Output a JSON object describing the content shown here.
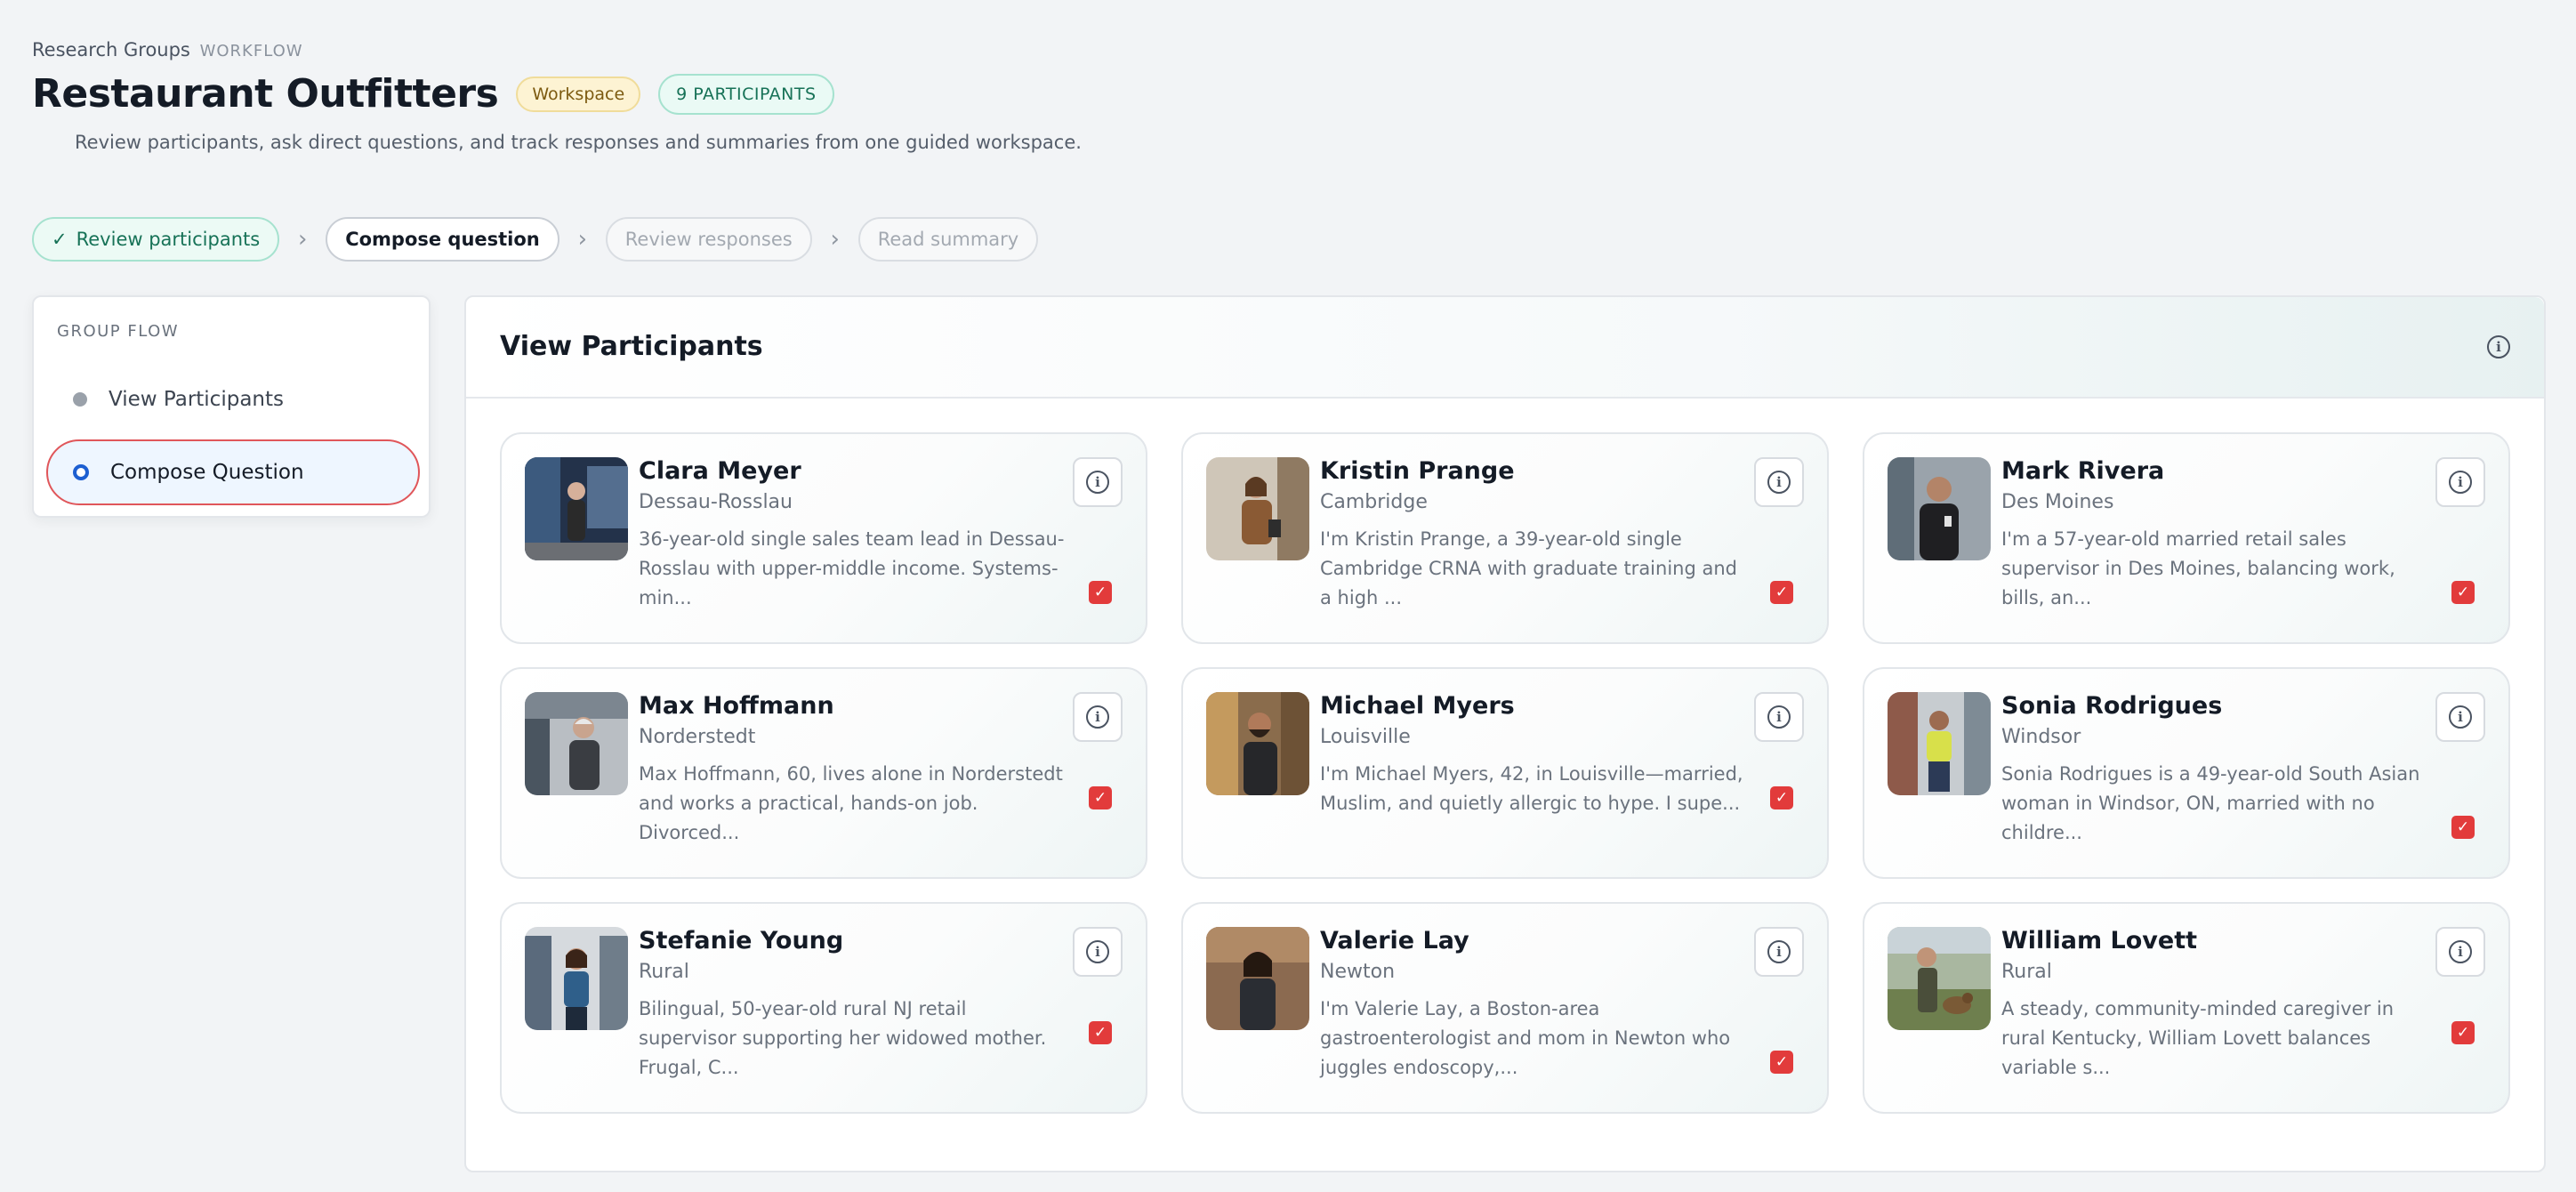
{
  "breadcrumb": {
    "root": "Research Groups",
    "section": "WORKFLOW"
  },
  "header": {
    "title": "Restaurant Outfitters",
    "badge_workspace": "Workspace",
    "badge_participants": "9 PARTICIPANTS",
    "description": "Review participants, ask direct questions, and track responses and summaries from one guided workspace."
  },
  "steps": [
    {
      "label": "Review participants",
      "state": "done"
    },
    {
      "label": "Compose question",
      "state": "active"
    },
    {
      "label": "Review responses",
      "state": "pending"
    },
    {
      "label": "Read summary",
      "state": "pending"
    }
  ],
  "sidebar": {
    "heading": "GROUP FLOW",
    "items": [
      {
        "label": "View Participants"
      },
      {
        "label": "Compose Question"
      }
    ]
  },
  "panel": {
    "title": "View Participants"
  },
  "colors": {
    "accent_red": "#e23b3b",
    "accent_teal": "#177257",
    "accent_blue": "#1d5fd1"
  },
  "participants": [
    {
      "name": "Clara Meyer",
      "city": "Dessau-Rosslau",
      "bio": "36-year-old single sales team lead in Dessau-Rosslau with upper-middle income. Systems-min...",
      "selected": true,
      "icon": "info-icon"
    },
    {
      "name": "Kristin Prange",
      "city": "Cambridge",
      "bio": "I'm Kristin Prange, a 39-year-old single Cambridge CRNA with graduate training and a high ...",
      "selected": true,
      "icon": "info-icon"
    },
    {
      "name": "Mark Rivera",
      "city": "Des Moines",
      "bio": "I'm a 57-year-old married retail sales supervisor in Des Moines, balancing work, bills, an...",
      "selected": true,
      "icon": "info-icon"
    },
    {
      "name": "Max Hoffmann",
      "city": "Norderstedt",
      "bio": "Max Hoffmann, 60, lives alone in Norderstedt and works a practical, hands-on job. Divorced...",
      "selected": true,
      "icon": "info-icon"
    },
    {
      "name": "Michael Myers",
      "city": "Louisville",
      "bio": "I'm Michael Myers, 42, in Louisville—married, Muslim, and quietly allergic to hype. I supe...",
      "selected": true,
      "icon": "info-icon"
    },
    {
      "name": "Sonia Rodrigues",
      "city": "Windsor",
      "bio": "Sonia Rodrigues is a 49-year-old South Asian woman in Windsor, ON, married with no childre...",
      "selected": true,
      "icon": "info-icon"
    },
    {
      "name": "Stefanie Young",
      "city": "Rural",
      "bio": "Bilingual, 50-year-old rural NJ retail supervisor supporting her widowed mother. Frugal, C...",
      "selected": true,
      "icon": "info-icon"
    },
    {
      "name": "Valerie Lay",
      "city": "Newton",
      "bio": "I'm Valerie Lay, a Boston-area gastroenterologist and mom in Newton who juggles endoscopy,...",
      "selected": true,
      "icon": "info-icon"
    },
    {
      "name": "William Lovett",
      "city": "Rural",
      "bio": "A steady, community-minded caregiver in rural Kentucky, William Lovett balances variable s...",
      "selected": true,
      "icon": "info-icon"
    }
  ]
}
